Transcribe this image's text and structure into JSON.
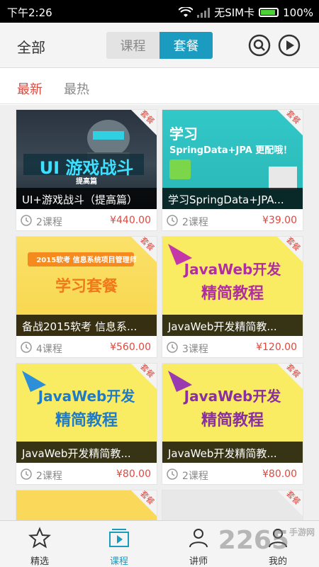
{
  "status_bar": {
    "time": "下午2:26",
    "carrier": "无SIM卡",
    "battery": "100%"
  },
  "header": {
    "title": "全部",
    "tabs": [
      {
        "label": "课程"
      },
      {
        "label": "套餐"
      }
    ]
  },
  "filter": {
    "latest": "最新",
    "hottest": "最热"
  },
  "ribbon_label": "套餐",
  "cards": [
    {
      "title": "UI+游戏战斗（提高篇）",
      "courses": "2课程",
      "price": "¥440.00",
      "thumb_text": "UI 游戏战斗",
      "thumb_sub": "提高篇"
    },
    {
      "title": "学习SpringData+JPA...",
      "courses": "2课程",
      "price": "¥39.00",
      "thumb_text": "学习",
      "thumb_sub": "SpringData+JPA 更配哦！"
    },
    {
      "title": "备战2015软考 信息系...",
      "courses": "4课程",
      "price": "¥560.00",
      "thumb_text": "学习套餐",
      "thumb_sub": "2015软考 信息系统项目管理师"
    },
    {
      "title": "JavaWeb开发精简教...",
      "courses": "3课程",
      "price": "¥120.00",
      "thumb_text": "JavaWeb开发",
      "thumb_sub": "精简教程"
    },
    {
      "title": "JavaWeb开发精简教...",
      "courses": "2课程",
      "price": "¥80.00",
      "thumb_text": "JavaWeb开发",
      "thumb_sub": "精简教程"
    },
    {
      "title": "JavaWeb开发精简教...",
      "courses": "2课程",
      "price": "¥80.00",
      "thumb_text": "JavaWeb开发",
      "thumb_sub": "精简教程"
    }
  ],
  "bottom_nav": [
    {
      "label": "精选",
      "icon": "star-icon"
    },
    {
      "label": "课程",
      "icon": "course-icon"
    },
    {
      "label": "讲师",
      "icon": "teacher-icon"
    },
    {
      "label": "我的",
      "icon": "profile-icon"
    }
  ],
  "watermark": "2265",
  "watermark_sub": "手游网",
  "colors": {
    "accent": "#1a9bbf",
    "price": "#e0473d"
  }
}
